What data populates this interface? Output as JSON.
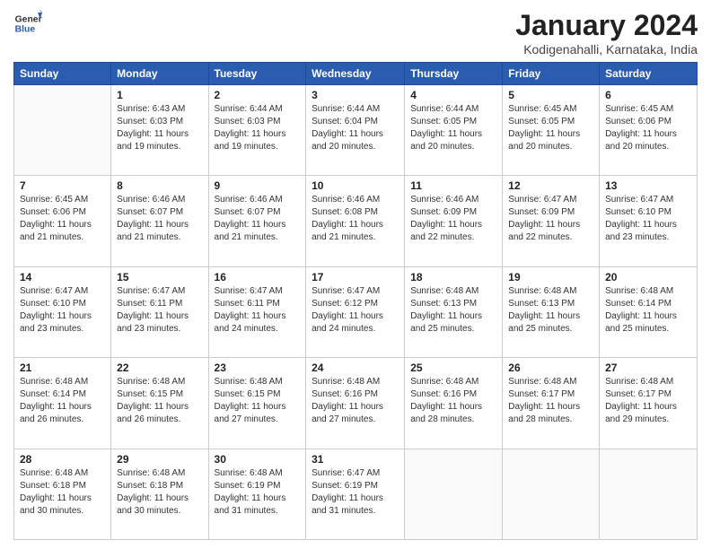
{
  "header": {
    "logo": {
      "general": "General",
      "blue": "Blue"
    },
    "title": "January 2024",
    "location": "Kodigenahalli, Karnataka, India"
  },
  "weekdays": [
    "Sunday",
    "Monday",
    "Tuesday",
    "Wednesday",
    "Thursday",
    "Friday",
    "Saturday"
  ],
  "weeks": [
    [
      {
        "num": "",
        "sunrise": "",
        "sunset": "",
        "daylight": ""
      },
      {
        "num": "1",
        "sunrise": "Sunrise: 6:43 AM",
        "sunset": "Sunset: 6:03 PM",
        "daylight": "Daylight: 11 hours and 19 minutes."
      },
      {
        "num": "2",
        "sunrise": "Sunrise: 6:44 AM",
        "sunset": "Sunset: 6:03 PM",
        "daylight": "Daylight: 11 hours and 19 minutes."
      },
      {
        "num": "3",
        "sunrise": "Sunrise: 6:44 AM",
        "sunset": "Sunset: 6:04 PM",
        "daylight": "Daylight: 11 hours and 20 minutes."
      },
      {
        "num": "4",
        "sunrise": "Sunrise: 6:44 AM",
        "sunset": "Sunset: 6:05 PM",
        "daylight": "Daylight: 11 hours and 20 minutes."
      },
      {
        "num": "5",
        "sunrise": "Sunrise: 6:45 AM",
        "sunset": "Sunset: 6:05 PM",
        "daylight": "Daylight: 11 hours and 20 minutes."
      },
      {
        "num": "6",
        "sunrise": "Sunrise: 6:45 AM",
        "sunset": "Sunset: 6:06 PM",
        "daylight": "Daylight: 11 hours and 20 minutes."
      }
    ],
    [
      {
        "num": "7",
        "sunrise": "Sunrise: 6:45 AM",
        "sunset": "Sunset: 6:06 PM",
        "daylight": "Daylight: 11 hours and 21 minutes."
      },
      {
        "num": "8",
        "sunrise": "Sunrise: 6:46 AM",
        "sunset": "Sunset: 6:07 PM",
        "daylight": "Daylight: 11 hours and 21 minutes."
      },
      {
        "num": "9",
        "sunrise": "Sunrise: 6:46 AM",
        "sunset": "Sunset: 6:07 PM",
        "daylight": "Daylight: 11 hours and 21 minutes."
      },
      {
        "num": "10",
        "sunrise": "Sunrise: 6:46 AM",
        "sunset": "Sunset: 6:08 PM",
        "daylight": "Daylight: 11 hours and 21 minutes."
      },
      {
        "num": "11",
        "sunrise": "Sunrise: 6:46 AM",
        "sunset": "Sunset: 6:09 PM",
        "daylight": "Daylight: 11 hours and 22 minutes."
      },
      {
        "num": "12",
        "sunrise": "Sunrise: 6:47 AM",
        "sunset": "Sunset: 6:09 PM",
        "daylight": "Daylight: 11 hours and 22 minutes."
      },
      {
        "num": "13",
        "sunrise": "Sunrise: 6:47 AM",
        "sunset": "Sunset: 6:10 PM",
        "daylight": "Daylight: 11 hours and 23 minutes."
      }
    ],
    [
      {
        "num": "14",
        "sunrise": "Sunrise: 6:47 AM",
        "sunset": "Sunset: 6:10 PM",
        "daylight": "Daylight: 11 hours and 23 minutes."
      },
      {
        "num": "15",
        "sunrise": "Sunrise: 6:47 AM",
        "sunset": "Sunset: 6:11 PM",
        "daylight": "Daylight: 11 hours and 23 minutes."
      },
      {
        "num": "16",
        "sunrise": "Sunrise: 6:47 AM",
        "sunset": "Sunset: 6:11 PM",
        "daylight": "Daylight: 11 hours and 24 minutes."
      },
      {
        "num": "17",
        "sunrise": "Sunrise: 6:47 AM",
        "sunset": "Sunset: 6:12 PM",
        "daylight": "Daylight: 11 hours and 24 minutes."
      },
      {
        "num": "18",
        "sunrise": "Sunrise: 6:48 AM",
        "sunset": "Sunset: 6:13 PM",
        "daylight": "Daylight: 11 hours and 25 minutes."
      },
      {
        "num": "19",
        "sunrise": "Sunrise: 6:48 AM",
        "sunset": "Sunset: 6:13 PM",
        "daylight": "Daylight: 11 hours and 25 minutes."
      },
      {
        "num": "20",
        "sunrise": "Sunrise: 6:48 AM",
        "sunset": "Sunset: 6:14 PM",
        "daylight": "Daylight: 11 hours and 25 minutes."
      }
    ],
    [
      {
        "num": "21",
        "sunrise": "Sunrise: 6:48 AM",
        "sunset": "Sunset: 6:14 PM",
        "daylight": "Daylight: 11 hours and 26 minutes."
      },
      {
        "num": "22",
        "sunrise": "Sunrise: 6:48 AM",
        "sunset": "Sunset: 6:15 PM",
        "daylight": "Daylight: 11 hours and 26 minutes."
      },
      {
        "num": "23",
        "sunrise": "Sunrise: 6:48 AM",
        "sunset": "Sunset: 6:15 PM",
        "daylight": "Daylight: 11 hours and 27 minutes."
      },
      {
        "num": "24",
        "sunrise": "Sunrise: 6:48 AM",
        "sunset": "Sunset: 6:16 PM",
        "daylight": "Daylight: 11 hours and 27 minutes."
      },
      {
        "num": "25",
        "sunrise": "Sunrise: 6:48 AM",
        "sunset": "Sunset: 6:16 PM",
        "daylight": "Daylight: 11 hours and 28 minutes."
      },
      {
        "num": "26",
        "sunrise": "Sunrise: 6:48 AM",
        "sunset": "Sunset: 6:17 PM",
        "daylight": "Daylight: 11 hours and 28 minutes."
      },
      {
        "num": "27",
        "sunrise": "Sunrise: 6:48 AM",
        "sunset": "Sunset: 6:17 PM",
        "daylight": "Daylight: 11 hours and 29 minutes."
      }
    ],
    [
      {
        "num": "28",
        "sunrise": "Sunrise: 6:48 AM",
        "sunset": "Sunset: 6:18 PM",
        "daylight": "Daylight: 11 hours and 30 minutes."
      },
      {
        "num": "29",
        "sunrise": "Sunrise: 6:48 AM",
        "sunset": "Sunset: 6:18 PM",
        "daylight": "Daylight: 11 hours and 30 minutes."
      },
      {
        "num": "30",
        "sunrise": "Sunrise: 6:48 AM",
        "sunset": "Sunset: 6:19 PM",
        "daylight": "Daylight: 11 hours and 31 minutes."
      },
      {
        "num": "31",
        "sunrise": "Sunrise: 6:47 AM",
        "sunset": "Sunset: 6:19 PM",
        "daylight": "Daylight: 11 hours and 31 minutes."
      },
      {
        "num": "",
        "sunrise": "",
        "sunset": "",
        "daylight": ""
      },
      {
        "num": "",
        "sunrise": "",
        "sunset": "",
        "daylight": ""
      },
      {
        "num": "",
        "sunrise": "",
        "sunset": "",
        "daylight": ""
      }
    ]
  ]
}
